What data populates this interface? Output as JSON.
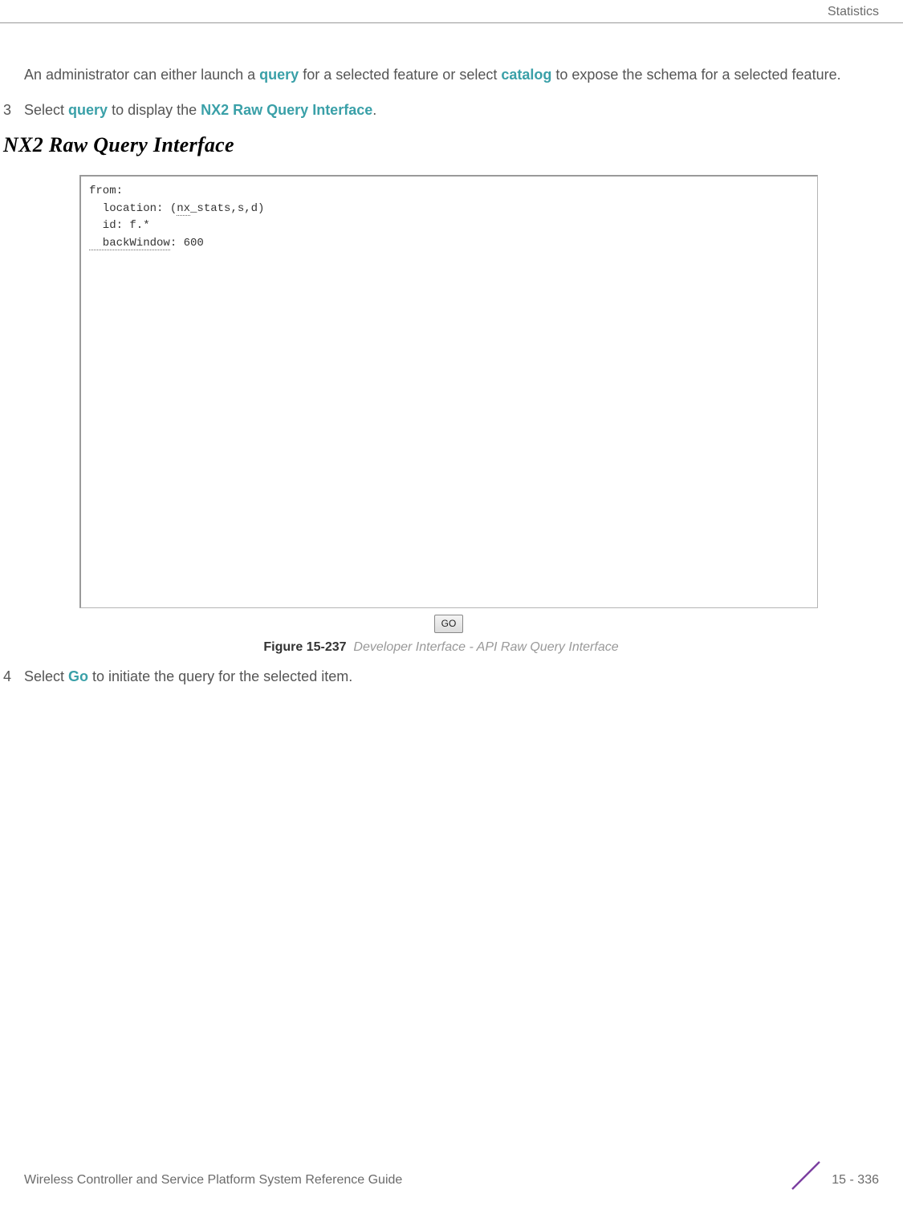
{
  "header": {
    "section": "Statistics"
  },
  "body": {
    "intro_pre": "An administrator can either launch a ",
    "intro_link_query": "query",
    "intro_mid": " for a selected feature or select ",
    "intro_link_catalog": "catalog",
    "intro_post": " to expose the schema for a selected feature.",
    "step3_num": "3",
    "step3_pre": "Select ",
    "step3_query": "query",
    "step3_mid": " to display the ",
    "step3_nx2": "NX2 Raw Query Interface",
    "step3_post": ".",
    "ui_title": "NX2 Raw Query Interface",
    "query_text": {
      "line1": "from:",
      "line2a": "  location: (",
      "line2b_u": "nx",
      "line2c": "_stats,s,d)",
      "line3": "  id: f.*",
      "line4a_u": "  backWindow",
      "line4b": ": 600"
    },
    "go_label": "GO",
    "caption_label": "Figure 15-237",
    "caption_text": "Developer Interface - API Raw Query Interface",
    "step4_num": "4",
    "step4_pre": "Select ",
    "step4_go": "Go",
    "step4_post": " to initiate the query for the selected item."
  },
  "footer": {
    "guide": "Wireless Controller and Service Platform System Reference Guide",
    "page": "15 - 336"
  },
  "colors": {
    "accent": "#3aa0a8",
    "slash": "#7b3fa0"
  }
}
